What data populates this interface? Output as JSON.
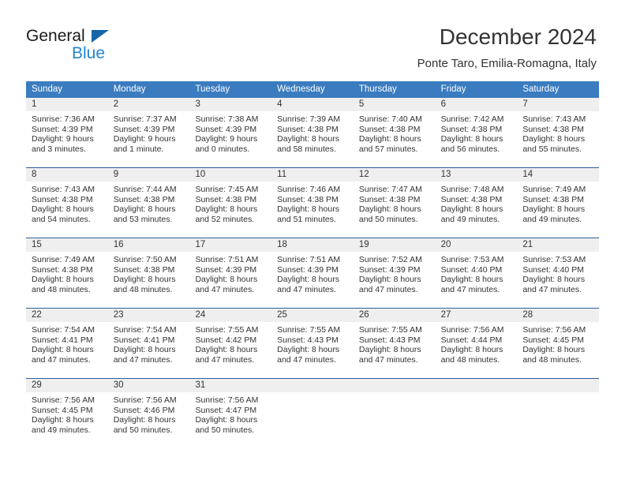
{
  "brand": {
    "name_part1": "General",
    "name_part2": "Blue",
    "triangle_icon": "blue-triangle-icon",
    "accent_color": "#2185d0",
    "triangle_color": "#1565a8"
  },
  "header": {
    "title": "December 2024",
    "location": "Ponte Taro, Emilia-Romagna, Italy"
  },
  "calendar": {
    "header_bg": "#3a7cbf",
    "daynum_bg": "#efefef",
    "row_border": "#2a6099",
    "weekdays": [
      "Sunday",
      "Monday",
      "Tuesday",
      "Wednesday",
      "Thursday",
      "Friday",
      "Saturday"
    ],
    "weeks": [
      [
        {
          "day": "1",
          "sunrise": "Sunrise: 7:36 AM",
          "sunset": "Sunset: 4:39 PM",
          "daylight_line1": "Daylight: 9 hours",
          "daylight_line2": "and 3 minutes."
        },
        {
          "day": "2",
          "sunrise": "Sunrise: 7:37 AM",
          "sunset": "Sunset: 4:39 PM",
          "daylight_line1": "Daylight: 9 hours",
          "daylight_line2": "and 1 minute."
        },
        {
          "day": "3",
          "sunrise": "Sunrise: 7:38 AM",
          "sunset": "Sunset: 4:39 PM",
          "daylight_line1": "Daylight: 9 hours",
          "daylight_line2": "and 0 minutes."
        },
        {
          "day": "4",
          "sunrise": "Sunrise: 7:39 AM",
          "sunset": "Sunset: 4:38 PM",
          "daylight_line1": "Daylight: 8 hours",
          "daylight_line2": "and 58 minutes."
        },
        {
          "day": "5",
          "sunrise": "Sunrise: 7:40 AM",
          "sunset": "Sunset: 4:38 PM",
          "daylight_line1": "Daylight: 8 hours",
          "daylight_line2": "and 57 minutes."
        },
        {
          "day": "6",
          "sunrise": "Sunrise: 7:42 AM",
          "sunset": "Sunset: 4:38 PM",
          "daylight_line1": "Daylight: 8 hours",
          "daylight_line2": "and 56 minutes."
        },
        {
          "day": "7",
          "sunrise": "Sunrise: 7:43 AM",
          "sunset": "Sunset: 4:38 PM",
          "daylight_line1": "Daylight: 8 hours",
          "daylight_line2": "and 55 minutes."
        }
      ],
      [
        {
          "day": "8",
          "sunrise": "Sunrise: 7:43 AM",
          "sunset": "Sunset: 4:38 PM",
          "daylight_line1": "Daylight: 8 hours",
          "daylight_line2": "and 54 minutes."
        },
        {
          "day": "9",
          "sunrise": "Sunrise: 7:44 AM",
          "sunset": "Sunset: 4:38 PM",
          "daylight_line1": "Daylight: 8 hours",
          "daylight_line2": "and 53 minutes."
        },
        {
          "day": "10",
          "sunrise": "Sunrise: 7:45 AM",
          "sunset": "Sunset: 4:38 PM",
          "daylight_line1": "Daylight: 8 hours",
          "daylight_line2": "and 52 minutes."
        },
        {
          "day": "11",
          "sunrise": "Sunrise: 7:46 AM",
          "sunset": "Sunset: 4:38 PM",
          "daylight_line1": "Daylight: 8 hours",
          "daylight_line2": "and 51 minutes."
        },
        {
          "day": "12",
          "sunrise": "Sunrise: 7:47 AM",
          "sunset": "Sunset: 4:38 PM",
          "daylight_line1": "Daylight: 8 hours",
          "daylight_line2": "and 50 minutes."
        },
        {
          "day": "13",
          "sunrise": "Sunrise: 7:48 AM",
          "sunset": "Sunset: 4:38 PM",
          "daylight_line1": "Daylight: 8 hours",
          "daylight_line2": "and 49 minutes."
        },
        {
          "day": "14",
          "sunrise": "Sunrise: 7:49 AM",
          "sunset": "Sunset: 4:38 PM",
          "daylight_line1": "Daylight: 8 hours",
          "daylight_line2": "and 49 minutes."
        }
      ],
      [
        {
          "day": "15",
          "sunrise": "Sunrise: 7:49 AM",
          "sunset": "Sunset: 4:38 PM",
          "daylight_line1": "Daylight: 8 hours",
          "daylight_line2": "and 48 minutes."
        },
        {
          "day": "16",
          "sunrise": "Sunrise: 7:50 AM",
          "sunset": "Sunset: 4:38 PM",
          "daylight_line1": "Daylight: 8 hours",
          "daylight_line2": "and 48 minutes."
        },
        {
          "day": "17",
          "sunrise": "Sunrise: 7:51 AM",
          "sunset": "Sunset: 4:39 PM",
          "daylight_line1": "Daylight: 8 hours",
          "daylight_line2": "and 47 minutes."
        },
        {
          "day": "18",
          "sunrise": "Sunrise: 7:51 AM",
          "sunset": "Sunset: 4:39 PM",
          "daylight_line1": "Daylight: 8 hours",
          "daylight_line2": "and 47 minutes."
        },
        {
          "day": "19",
          "sunrise": "Sunrise: 7:52 AM",
          "sunset": "Sunset: 4:39 PM",
          "daylight_line1": "Daylight: 8 hours",
          "daylight_line2": "and 47 minutes."
        },
        {
          "day": "20",
          "sunrise": "Sunrise: 7:53 AM",
          "sunset": "Sunset: 4:40 PM",
          "daylight_line1": "Daylight: 8 hours",
          "daylight_line2": "and 47 minutes."
        },
        {
          "day": "21",
          "sunrise": "Sunrise: 7:53 AM",
          "sunset": "Sunset: 4:40 PM",
          "daylight_line1": "Daylight: 8 hours",
          "daylight_line2": "and 47 minutes."
        }
      ],
      [
        {
          "day": "22",
          "sunrise": "Sunrise: 7:54 AM",
          "sunset": "Sunset: 4:41 PM",
          "daylight_line1": "Daylight: 8 hours",
          "daylight_line2": "and 47 minutes."
        },
        {
          "day": "23",
          "sunrise": "Sunrise: 7:54 AM",
          "sunset": "Sunset: 4:41 PM",
          "daylight_line1": "Daylight: 8 hours",
          "daylight_line2": "and 47 minutes."
        },
        {
          "day": "24",
          "sunrise": "Sunrise: 7:55 AM",
          "sunset": "Sunset: 4:42 PM",
          "daylight_line1": "Daylight: 8 hours",
          "daylight_line2": "and 47 minutes."
        },
        {
          "day": "25",
          "sunrise": "Sunrise: 7:55 AM",
          "sunset": "Sunset: 4:43 PM",
          "daylight_line1": "Daylight: 8 hours",
          "daylight_line2": "and 47 minutes."
        },
        {
          "day": "26",
          "sunrise": "Sunrise: 7:55 AM",
          "sunset": "Sunset: 4:43 PM",
          "daylight_line1": "Daylight: 8 hours",
          "daylight_line2": "and 47 minutes."
        },
        {
          "day": "27",
          "sunrise": "Sunrise: 7:56 AM",
          "sunset": "Sunset: 4:44 PM",
          "daylight_line1": "Daylight: 8 hours",
          "daylight_line2": "and 48 minutes."
        },
        {
          "day": "28",
          "sunrise": "Sunrise: 7:56 AM",
          "sunset": "Sunset: 4:45 PM",
          "daylight_line1": "Daylight: 8 hours",
          "daylight_line2": "and 48 minutes."
        }
      ],
      [
        {
          "day": "29",
          "sunrise": "Sunrise: 7:56 AM",
          "sunset": "Sunset: 4:45 PM",
          "daylight_line1": "Daylight: 8 hours",
          "daylight_line2": "and 49 minutes."
        },
        {
          "day": "30",
          "sunrise": "Sunrise: 7:56 AM",
          "sunset": "Sunset: 4:46 PM",
          "daylight_line1": "Daylight: 8 hours",
          "daylight_line2": "and 50 minutes."
        },
        {
          "day": "31",
          "sunrise": "Sunrise: 7:56 AM",
          "sunset": "Sunset: 4:47 PM",
          "daylight_line1": "Daylight: 8 hours",
          "daylight_line2": "and 50 minutes."
        },
        {
          "day": "",
          "sunrise": "",
          "sunset": "",
          "daylight_line1": "",
          "daylight_line2": ""
        },
        {
          "day": "",
          "sunrise": "",
          "sunset": "",
          "daylight_line1": "",
          "daylight_line2": ""
        },
        {
          "day": "",
          "sunrise": "",
          "sunset": "",
          "daylight_line1": "",
          "daylight_line2": ""
        },
        {
          "day": "",
          "sunrise": "",
          "sunset": "",
          "daylight_line1": "",
          "daylight_line2": ""
        }
      ]
    ]
  }
}
